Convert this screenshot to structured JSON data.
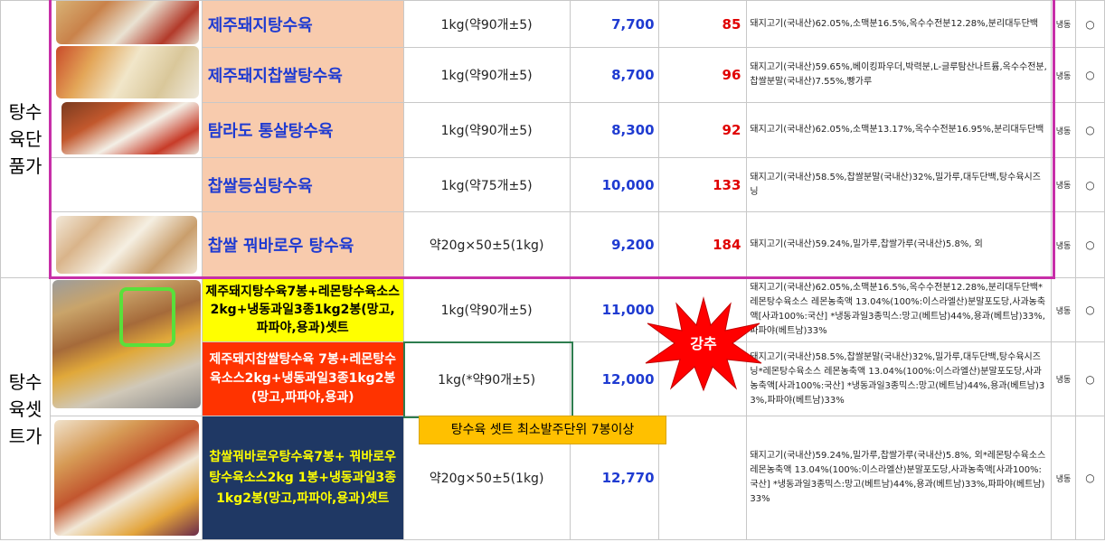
{
  "categories": {
    "single": "탕수육단품가",
    "set": "탕수육셋트가"
  },
  "rows": [
    {
      "name": "제주돼지탕수육",
      "spec": "1kg(약90개±5)",
      "price": "7,700",
      "qty": "85",
      "ingredients": "돼지고기(국내산)62.05%,소맥분16.5%,옥수수전분12.28%,분리대두단백",
      "storage": "냉동",
      "mark": "○"
    },
    {
      "name": "제주돼지찹쌀탕수육",
      "spec": "1kg(약90개±5)",
      "price": "8,700",
      "qty": "96",
      "ingredients": "돼지고기(국내산)59.65%,베이킹파우더,박력분,L-글루탐산나트륨,옥수수전분,찹쌀분말(국내산)7.55%,빵가루",
      "storage": "냉동",
      "mark": "○"
    },
    {
      "name": "탐라도 통살탕수육",
      "spec": "1kg(약90개±5)",
      "price": "8,300",
      "qty": "92",
      "ingredients": "돼지고기(국내산)62.05%,소맥분13.17%,옥수수전분16.95%,분리대두단백",
      "storage": "냉동",
      "mark": "○"
    },
    {
      "name": "찹쌀등심탕수육",
      "spec": "1kg(약75개±5)",
      "price": "10,000",
      "qty": "133",
      "ingredients": "돼지고기(국내산)58.5%,찹쌀분말(국내산)32%,밀가루,대두단백,탕수육시즈닝",
      "storage": "냉동",
      "mark": "○"
    },
    {
      "name": "찹쌀 꿔바로우 탕수육",
      "spec": "약20g×50±5(1kg)",
      "price": "9,200",
      "qty": "184",
      "ingredients": "돼지고기(국내산)59.24%,밀가루,찹쌀가루(국내산)5.8%, 외",
      "storage": "냉동",
      "mark": "○"
    },
    {
      "name": "제주돼지탕수육7봉+레몬탕수육소스2kg+냉동과일3종1kg2봉(망고,파파야,용과)셋트",
      "spec": "1kg(약90개±5)",
      "price": "11,000",
      "qty": "",
      "ingredients": "돼지고기(국내산)62.05%,소맥분16.5%,옥수수전분12.28%,분리대두단백*레몬탕수육소스 레몬농축액 13.04%(100%:이스라엘산)분말포도당,사과농축액[사과100%:국산] *냉동과일3종믹스:망고(베트남)44%,용과(베트남)33%,파파야(베트남)33%",
      "storage": "냉동",
      "mark": "○"
    },
    {
      "name": "제주돼지찹쌀탕수육 7봉+레몬탕수육소스2kg+냉동과일3종1kg2봉(망고,파파야,용과)",
      "spec": "1kg(*약90개±5)",
      "price": "12,000",
      "qty": "",
      "ingredients": "돼지고기(국내산)58.5%,찹쌀분말(국내산)32%,밀가루,대두단백,탕수육시즈닝*레몬탕수육소스 레몬농축액 13.04%(100%:이스라엘산)분말포도당,사과농축액[사과100%:국산] *냉동과일3종믹스:망고(베트남)44%,용과(베트남)33%,파파야(베트남)33%",
      "storage": "냉동",
      "mark": "○"
    },
    {
      "name": "찹쌀꿔바로우탕수육7봉+ 꿔바로우탕수육소스2kg 1봉+냉동과일3종1kg2봉(망고,파파야,용과)셋트",
      "spec": "약20g×50±5(1kg)",
      "price": "12,770",
      "qty": "",
      "ingredients": "돼지고기(국내산)59.24%,밀가루,찹쌀가루(국내산)5.8%, 외*레몬탕수육소스 레몬농축액 13.04%(100%:이스라엘산)분말포도당,사과농축액[사과100%:국산] *냉동과일3종믹스:망고(베트남)44%,용과(베트남)33%,파파야(베트남)33%",
      "storage": "냉동",
      "mark": "○"
    }
  ],
  "callouts": {
    "burst": "강추",
    "note": "탕수육 셋트 최소발주단위 7봉이상"
  },
  "colors": {
    "frame_pink": "#c72fa8",
    "name_peach": "#f8cbad",
    "price_blue": "#1f3bd1",
    "qty_red": "#e00000",
    "note_orange": "#ffc000"
  }
}
